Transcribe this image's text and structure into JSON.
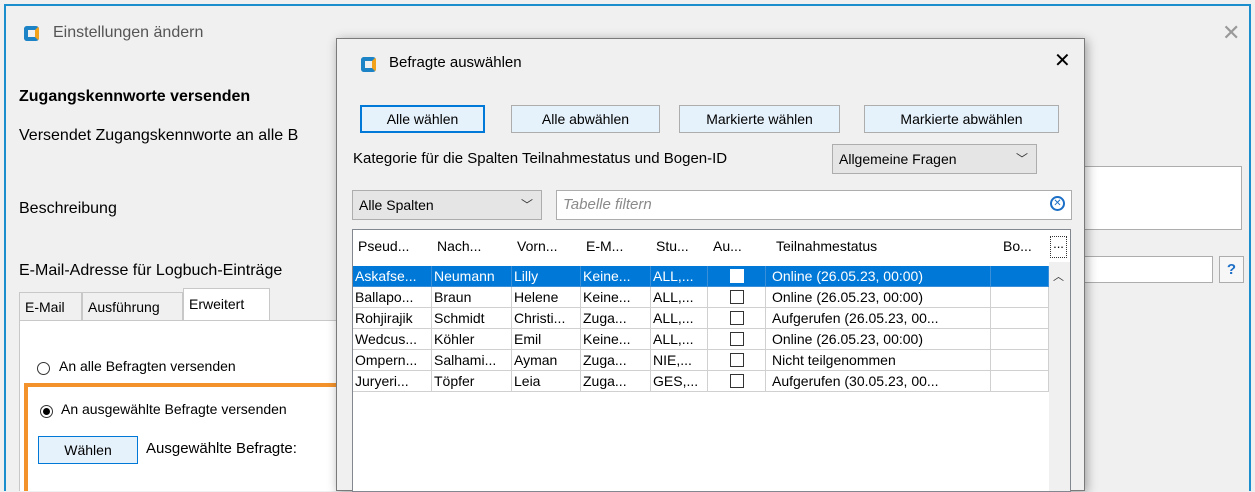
{
  "main": {
    "title": "Einstellungen ändern",
    "section_title": "Zugangskennworte versenden",
    "section_desc": "Versendet Zugangskennworte an alle B",
    "description_label": "Beschreibung",
    "logbook_label": "E-Mail-Adresse für Logbuch-Einträge",
    "help_label": "?",
    "tabs": [
      {
        "label": "E-Mail"
      },
      {
        "label": "Ausführung"
      },
      {
        "label": "Erweitert"
      }
    ],
    "radio_all": "An alle Befragten versenden",
    "radio_selected": "An ausgewählte Befragte versenden",
    "choose_button": "Wählen",
    "selected_label": "Ausgewählte Befragte:"
  },
  "dialog": {
    "title": "Befragte auswählen",
    "buttons": {
      "select_all": "Alle wählen",
      "deselect_all": "Alle abwählen",
      "select_marked": "Markierte wählen",
      "deselect_marked": "Markierte abwählen"
    },
    "category_label": "Kategorie für die Spalten Teilnahmestatus und Bogen-ID",
    "category_value": "Allgemeine Fragen",
    "columns_value": "Alle Spalten",
    "filter_placeholder": "Tabelle filtern",
    "columns": [
      "Pseud...",
      "Nach...",
      "Vorn...",
      "E-M...",
      "Stu...",
      "Au...",
      "Teilnahmestatus",
      "Bo..."
    ],
    "header_more": "...",
    "rows": [
      {
        "cells": [
          "Askafse...",
          "Neumann",
          "Lilly",
          "Keine...",
          "ALL,...",
          "Online (26.05.23, 00:00)",
          ""
        ],
        "selected": true
      },
      {
        "cells": [
          "Ballapo...",
          "Braun",
          "Helene",
          "Keine...",
          "ALL,...",
          "Online (26.05.23, 00:00)",
          ""
        ],
        "selected": false
      },
      {
        "cells": [
          "Rohjirajik",
          "Schmidt",
          "Christi...",
          "Zuga...",
          "ALL,...",
          "Aufgerufen (26.05.23, 00...",
          ""
        ],
        "selected": false
      },
      {
        "cells": [
          "Wedcus...",
          "Köhler",
          "Emil",
          "Keine...",
          "ALL,...",
          "Online (26.05.23, 00:00)",
          ""
        ],
        "selected": false
      },
      {
        "cells": [
          "Ompern...",
          "Salhami...",
          "Ayman",
          "Zuga...",
          "NIE,...",
          "Nicht teilgenommen",
          ""
        ],
        "selected": false
      },
      {
        "cells": [
          "Juryeri...",
          "Töpfer",
          "Leia",
          "Zuga...",
          "GES,...",
          "Aufgerufen (30.05.23, 00...",
          ""
        ],
        "selected": false
      }
    ]
  },
  "colors": {
    "accent": "#0078d7",
    "highlight_border": "#f3922b",
    "window_border": "#1b8fce"
  }
}
